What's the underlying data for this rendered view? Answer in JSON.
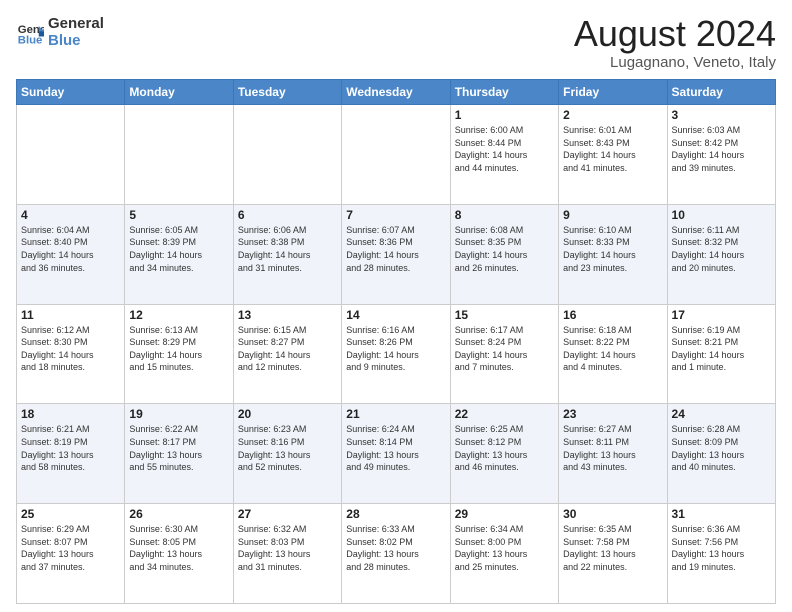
{
  "header": {
    "logo_line1": "General",
    "logo_line2": "Blue",
    "title": "August 2024",
    "subtitle": "Lugagnano, Veneto, Italy"
  },
  "weekdays": [
    "Sunday",
    "Monday",
    "Tuesday",
    "Wednesday",
    "Thursday",
    "Friday",
    "Saturday"
  ],
  "weeks": [
    [
      {
        "day": "",
        "info": ""
      },
      {
        "day": "",
        "info": ""
      },
      {
        "day": "",
        "info": ""
      },
      {
        "day": "",
        "info": ""
      },
      {
        "day": "1",
        "info": "Sunrise: 6:00 AM\nSunset: 8:44 PM\nDaylight: 14 hours\nand 44 minutes."
      },
      {
        "day": "2",
        "info": "Sunrise: 6:01 AM\nSunset: 8:43 PM\nDaylight: 14 hours\nand 41 minutes."
      },
      {
        "day": "3",
        "info": "Sunrise: 6:03 AM\nSunset: 8:42 PM\nDaylight: 14 hours\nand 39 minutes."
      }
    ],
    [
      {
        "day": "4",
        "info": "Sunrise: 6:04 AM\nSunset: 8:40 PM\nDaylight: 14 hours\nand 36 minutes."
      },
      {
        "day": "5",
        "info": "Sunrise: 6:05 AM\nSunset: 8:39 PM\nDaylight: 14 hours\nand 34 minutes."
      },
      {
        "day": "6",
        "info": "Sunrise: 6:06 AM\nSunset: 8:38 PM\nDaylight: 14 hours\nand 31 minutes."
      },
      {
        "day": "7",
        "info": "Sunrise: 6:07 AM\nSunset: 8:36 PM\nDaylight: 14 hours\nand 28 minutes."
      },
      {
        "day": "8",
        "info": "Sunrise: 6:08 AM\nSunset: 8:35 PM\nDaylight: 14 hours\nand 26 minutes."
      },
      {
        "day": "9",
        "info": "Sunrise: 6:10 AM\nSunset: 8:33 PM\nDaylight: 14 hours\nand 23 minutes."
      },
      {
        "day": "10",
        "info": "Sunrise: 6:11 AM\nSunset: 8:32 PM\nDaylight: 14 hours\nand 20 minutes."
      }
    ],
    [
      {
        "day": "11",
        "info": "Sunrise: 6:12 AM\nSunset: 8:30 PM\nDaylight: 14 hours\nand 18 minutes."
      },
      {
        "day": "12",
        "info": "Sunrise: 6:13 AM\nSunset: 8:29 PM\nDaylight: 14 hours\nand 15 minutes."
      },
      {
        "day": "13",
        "info": "Sunrise: 6:15 AM\nSunset: 8:27 PM\nDaylight: 14 hours\nand 12 minutes."
      },
      {
        "day": "14",
        "info": "Sunrise: 6:16 AM\nSunset: 8:26 PM\nDaylight: 14 hours\nand 9 minutes."
      },
      {
        "day": "15",
        "info": "Sunrise: 6:17 AM\nSunset: 8:24 PM\nDaylight: 14 hours\nand 7 minutes."
      },
      {
        "day": "16",
        "info": "Sunrise: 6:18 AM\nSunset: 8:22 PM\nDaylight: 14 hours\nand 4 minutes."
      },
      {
        "day": "17",
        "info": "Sunrise: 6:19 AM\nSunset: 8:21 PM\nDaylight: 14 hours\nand 1 minute."
      }
    ],
    [
      {
        "day": "18",
        "info": "Sunrise: 6:21 AM\nSunset: 8:19 PM\nDaylight: 13 hours\nand 58 minutes."
      },
      {
        "day": "19",
        "info": "Sunrise: 6:22 AM\nSunset: 8:17 PM\nDaylight: 13 hours\nand 55 minutes."
      },
      {
        "day": "20",
        "info": "Sunrise: 6:23 AM\nSunset: 8:16 PM\nDaylight: 13 hours\nand 52 minutes."
      },
      {
        "day": "21",
        "info": "Sunrise: 6:24 AM\nSunset: 8:14 PM\nDaylight: 13 hours\nand 49 minutes."
      },
      {
        "day": "22",
        "info": "Sunrise: 6:25 AM\nSunset: 8:12 PM\nDaylight: 13 hours\nand 46 minutes."
      },
      {
        "day": "23",
        "info": "Sunrise: 6:27 AM\nSunset: 8:11 PM\nDaylight: 13 hours\nand 43 minutes."
      },
      {
        "day": "24",
        "info": "Sunrise: 6:28 AM\nSunset: 8:09 PM\nDaylight: 13 hours\nand 40 minutes."
      }
    ],
    [
      {
        "day": "25",
        "info": "Sunrise: 6:29 AM\nSunset: 8:07 PM\nDaylight: 13 hours\nand 37 minutes."
      },
      {
        "day": "26",
        "info": "Sunrise: 6:30 AM\nSunset: 8:05 PM\nDaylight: 13 hours\nand 34 minutes."
      },
      {
        "day": "27",
        "info": "Sunrise: 6:32 AM\nSunset: 8:03 PM\nDaylight: 13 hours\nand 31 minutes."
      },
      {
        "day": "28",
        "info": "Sunrise: 6:33 AM\nSunset: 8:02 PM\nDaylight: 13 hours\nand 28 minutes."
      },
      {
        "day": "29",
        "info": "Sunrise: 6:34 AM\nSunset: 8:00 PM\nDaylight: 13 hours\nand 25 minutes."
      },
      {
        "day": "30",
        "info": "Sunrise: 6:35 AM\nSunset: 7:58 PM\nDaylight: 13 hours\nand 22 minutes."
      },
      {
        "day": "31",
        "info": "Sunrise: 6:36 AM\nSunset: 7:56 PM\nDaylight: 13 hours\nand 19 minutes."
      }
    ]
  ]
}
